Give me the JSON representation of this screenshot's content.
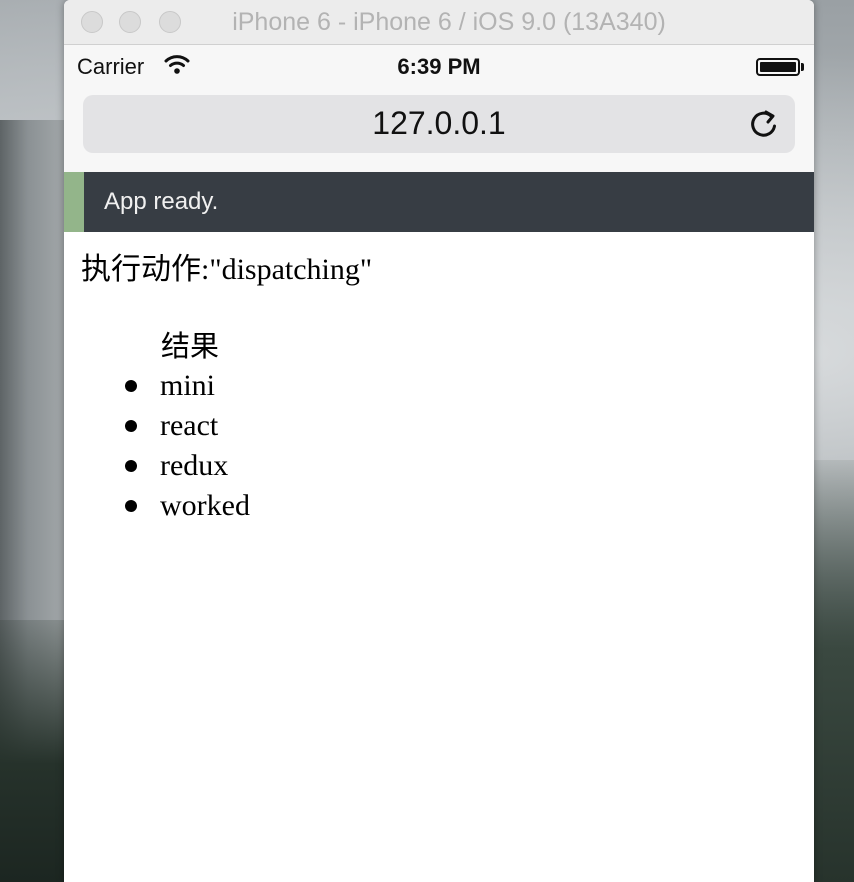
{
  "window": {
    "title": "iPhone 6 - iPhone 6 / iOS 9.0 (13A340)"
  },
  "status_bar": {
    "carrier": "Carrier",
    "time": "6:39 PM"
  },
  "browser": {
    "url": "127.0.0.1"
  },
  "banner": {
    "text": "App ready."
  },
  "content": {
    "action_label": "执行动作:\"dispatching\"",
    "result_title": "结果",
    "items": [
      "mini",
      "react",
      "redux",
      "worked"
    ]
  },
  "colors": {
    "banner_bg": "#373d44",
    "banner_accent": "#93b58a"
  }
}
